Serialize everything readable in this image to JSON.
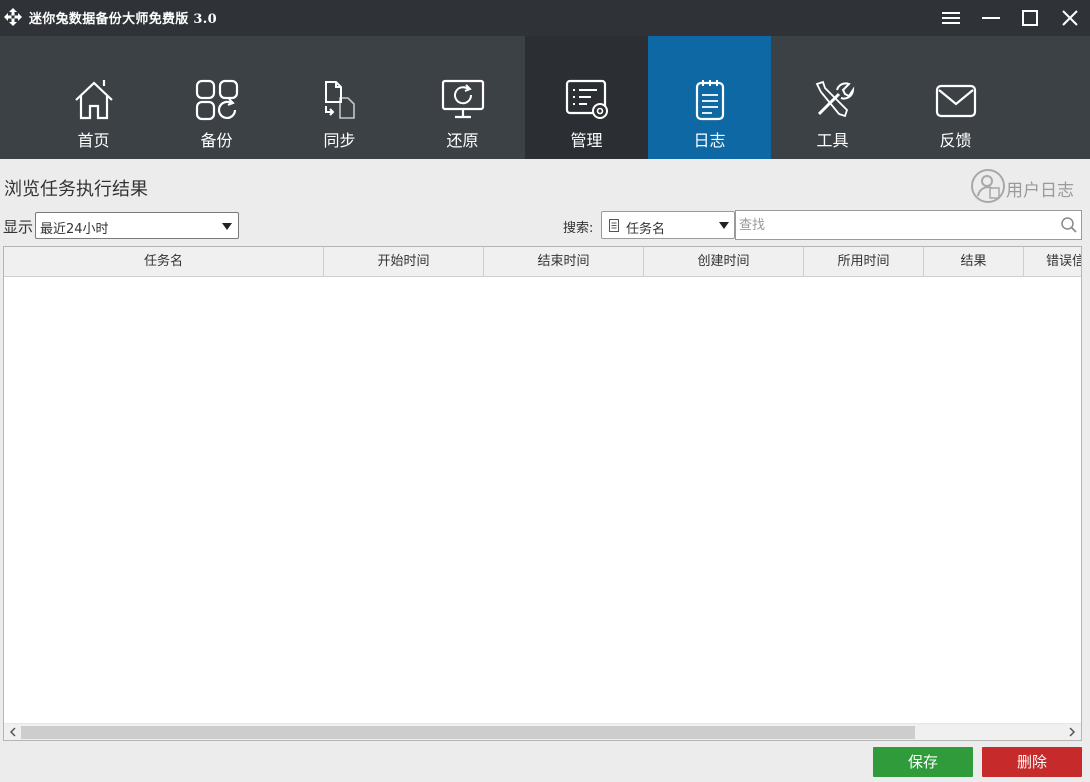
{
  "app": {
    "title": "迷你兔数据备份大师免费版 3.0"
  },
  "window_controls": [
    "menu-icon",
    "minimize-icon",
    "maximize-icon",
    "close-icon"
  ],
  "nav": {
    "items": [
      {
        "label": "首页",
        "icon": "home-icon"
      },
      {
        "label": "备份",
        "icon": "backup-icon"
      },
      {
        "label": "同步",
        "icon": "sync-icon"
      },
      {
        "label": "还原",
        "icon": "restore-icon"
      },
      {
        "label": "管理",
        "icon": "manage-icon"
      },
      {
        "label": "日志",
        "icon": "log-icon"
      },
      {
        "label": "工具",
        "icon": "tools-icon"
      },
      {
        "label": "反馈",
        "icon": "feedback-icon"
      }
    ],
    "active": "日志"
  },
  "page": {
    "title": "浏览任务执行结果",
    "user_log_label": "用户日志"
  },
  "filter": {
    "show_label": "显示",
    "show_value": "最近24小时",
    "search_label": "搜索:",
    "search_field": "任务名",
    "search_placeholder": "查找"
  },
  "table": {
    "columns": [
      "任务名",
      "开始时间",
      "结束时间",
      "创建时间",
      "所用时间",
      "结果",
      "错误信息"
    ],
    "rows": []
  },
  "actions": {
    "save_label": "保存",
    "delete_label": "删除"
  },
  "colors": {
    "titlebar_bg": "#2f3337",
    "toolbar_bg": "#3c4145",
    "active_tab": "#0d68a3",
    "save_button": "#2f9b3a",
    "delete_button": "#c72a2a"
  }
}
